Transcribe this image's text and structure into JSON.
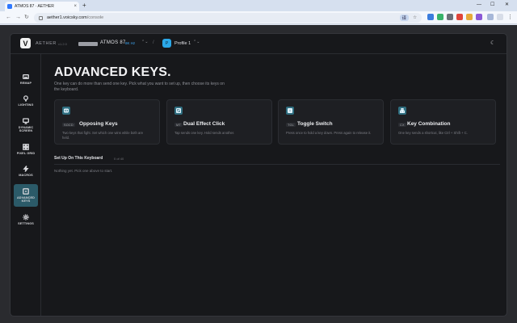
{
  "browser": {
    "tab_title": "ATMOS 87 · AETHER",
    "url_host": "aether1.voicsky.com",
    "url_path": "/console",
    "translate_label": "译",
    "nav_back": "←",
    "nav_forward": "→",
    "nav_reload": "↻",
    "new_tab": "+",
    "win_min": "—",
    "win_max": "☐",
    "win_close": "✕"
  },
  "app": {
    "logo": "V",
    "brand": "AETHER",
    "version": "v1.2.0",
    "device_name": "ATMOS 87",
    "device_hz": "8K Hz",
    "separator": "/",
    "profile_badge": "P",
    "profile_name": "Profile 1"
  },
  "sidebar": {
    "items": [
      {
        "label": "REMAP",
        "icon": "keyboard-icon"
      },
      {
        "label": "LIGHTING",
        "icon": "lightbulb-icon"
      },
      {
        "label": "DYNAMIC\nSCREEN",
        "icon": "monitor-icon"
      },
      {
        "label": "PIXEL GRID",
        "icon": "grid-icon"
      },
      {
        "label": "MACROS",
        "icon": "bolt-icon"
      },
      {
        "label": "ADVANCED\nKEYS",
        "icon": "advanced-keys-icon",
        "active": true
      },
      {
        "label": "SETTINGS",
        "icon": "gear-icon"
      }
    ]
  },
  "page": {
    "title": "ADVANCED KEYS.",
    "description": "One key can do more than send one key. Pick what you want to set up, then choose its keys on the keyboard.",
    "cards": [
      {
        "code": "SOCD",
        "title": "Opposing Keys",
        "desc": "Two keys that fight. Set which one wins while both are held.",
        "icon": "opposing-keys-icon"
      },
      {
        "code": "MT",
        "title": "Dual Effect Click",
        "desc": "Tap sends one key. Hold sends another.",
        "icon": "dual-effect-icon"
      },
      {
        "code": "TGL",
        "title": "Toggle Switch",
        "desc": "Press once to hold a key down. Press again to release it.",
        "icon": "toggle-switch-icon"
      },
      {
        "code": "CX",
        "title": "Key Combination",
        "desc": "One key sends a shortcut, like Ctrl + Shift + C.",
        "icon": "key-combination-icon"
      }
    ],
    "section_title": "Set Up On This Keyboard",
    "section_count": "0 of 40",
    "empty_text": "Nothing yet. Pick one above to start."
  },
  "colors": {
    "accent": "#3fa8f5",
    "active_nav": "#2b5a68",
    "card_icon": "#2f6e80"
  }
}
